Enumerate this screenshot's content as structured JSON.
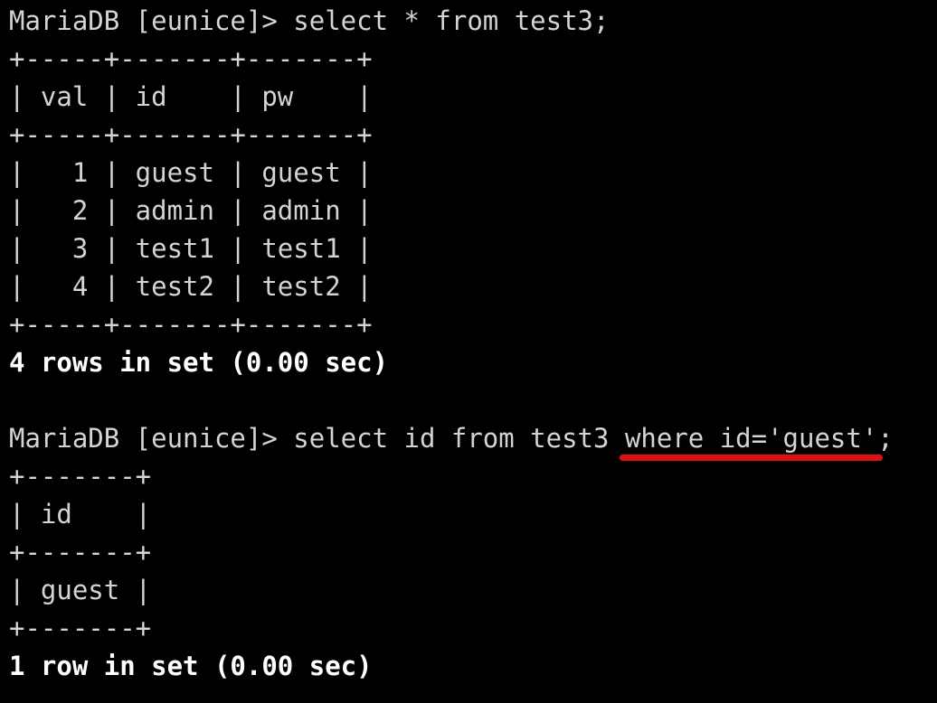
{
  "terminal": {
    "query1": {
      "prompt": "MariaDB [eunice]> ",
      "command": "select * from test3;",
      "table_lines": [
        "+-----+-------+-------+",
        "| val | id    | pw    |",
        "+-----+-------+-------+",
        "|   1 | guest | guest |",
        "|   2 | admin | admin |",
        "|   3 | test1 | test1 |",
        "|   4 | test2 | test2 |",
        "+-----+-------+-------+"
      ],
      "result": "4 rows in set (0.00 sec)"
    },
    "query2": {
      "prompt": "MariaDB [eunice]> ",
      "command_prefix": "select id from test3 ",
      "command_highlight": "where id='guest'",
      "command_suffix": ";",
      "table_lines": [
        "+-------+",
        "| id    |",
        "+-------+",
        "| guest |",
        "+-------+"
      ],
      "result": "1 row in set (0.00 sec)"
    },
    "colors": {
      "background": "#000000",
      "text": "#d4d4d4",
      "highlight_underline": "#e01010"
    }
  }
}
